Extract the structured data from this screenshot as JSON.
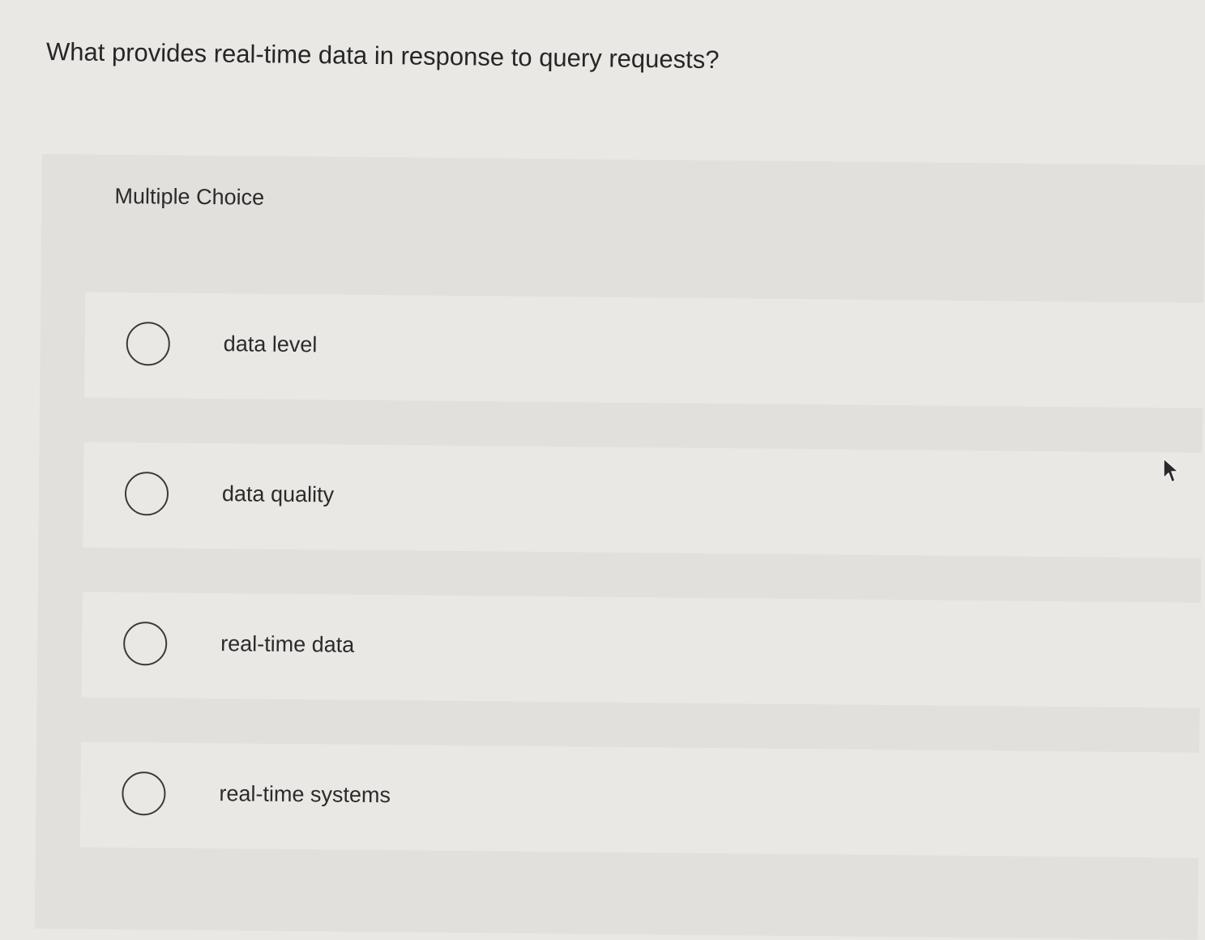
{
  "question": {
    "text": "What provides real-time data in response to query requests?"
  },
  "panel": {
    "header": "Multiple Choice",
    "options": [
      {
        "label": "data level",
        "selected": false
      },
      {
        "label": "data quality",
        "selected": false
      },
      {
        "label": "real-time data",
        "selected": false
      },
      {
        "label": "real-time systems",
        "selected": false
      }
    ]
  },
  "icons": {
    "cursor": "mouse-pointer-icon",
    "radio": "radio-unchecked-icon"
  }
}
